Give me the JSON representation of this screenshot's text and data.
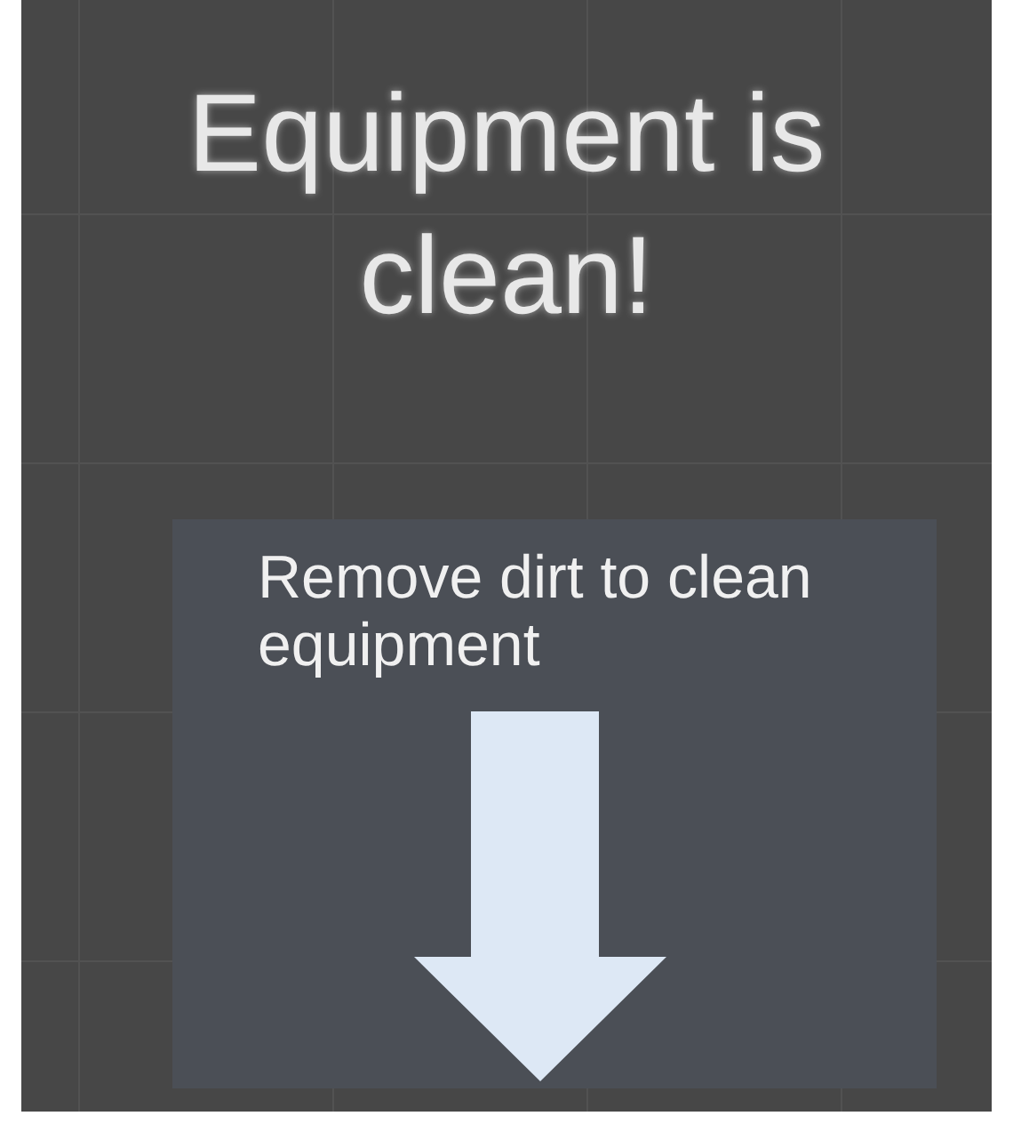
{
  "title": "Equipment is clean!",
  "panel": {
    "instruction": "Remove dirt to clean equipment"
  }
}
